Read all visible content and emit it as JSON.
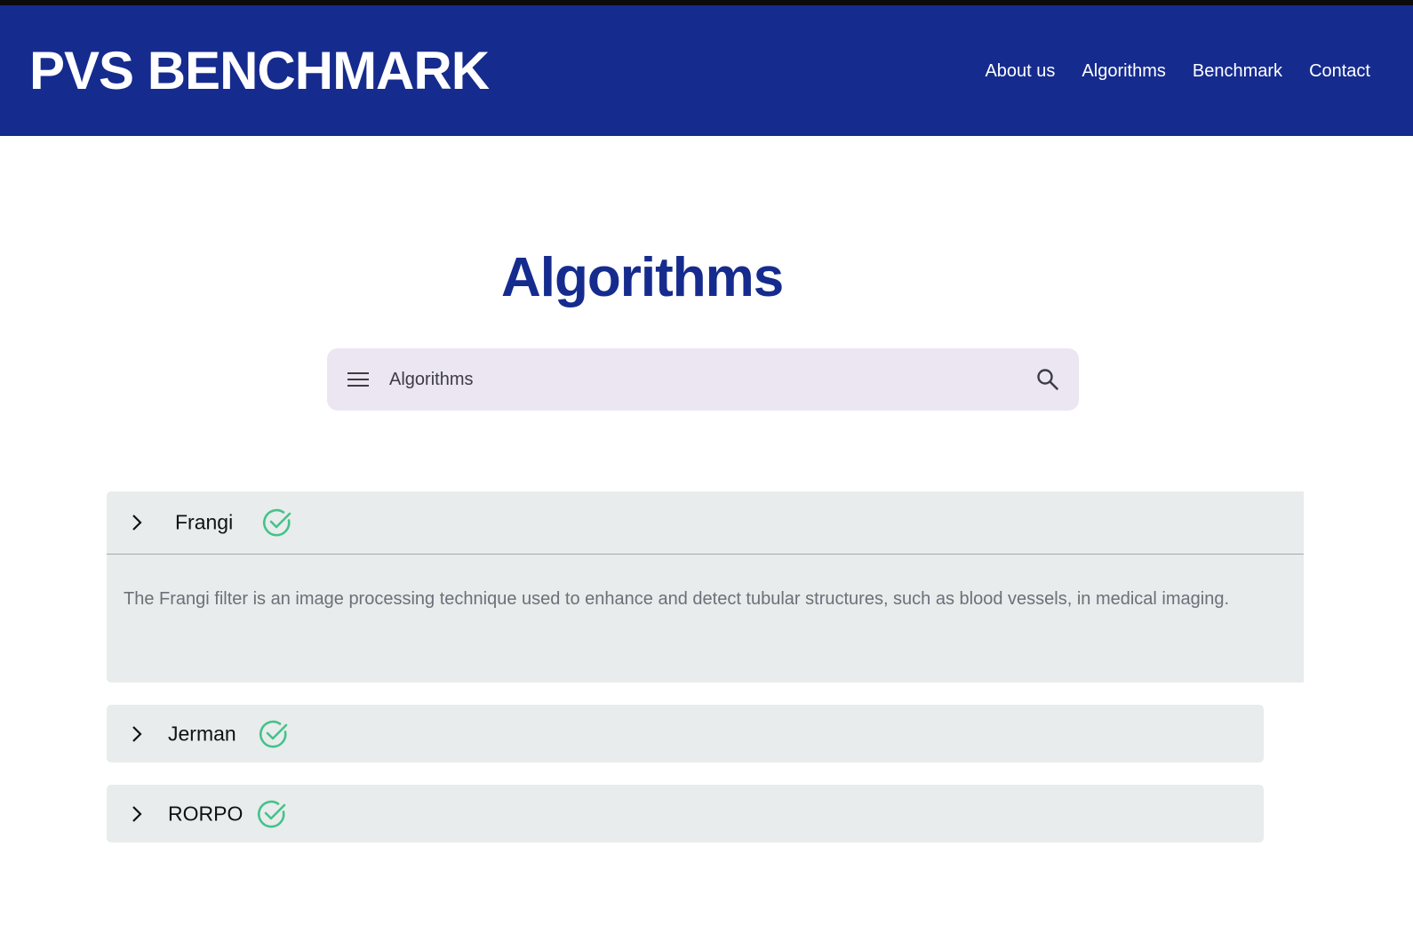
{
  "site": {
    "brand": "PVS BENCHMARK",
    "nav": [
      "About us",
      "Algorithms",
      "Benchmark",
      "Contact"
    ]
  },
  "page": {
    "title": "Algorithms"
  },
  "search": {
    "placeholder": "Algorithms",
    "value": "",
    "menu_icon": "menu-icon",
    "search_icon": "search-icon"
  },
  "algorithms": [
    {
      "name": "Frangi",
      "expanded": true,
      "status_icon": "check-circle-icon",
      "description": "The Frangi filter is an image processing technique used to enhance and detect tubular structures, such as blood vessels, in medical imaging."
    },
    {
      "name": "Jerman",
      "expanded": false,
      "status_icon": "check-circle-icon"
    },
    {
      "name": "RORPO",
      "expanded": false,
      "status_icon": "check-circle-icon"
    }
  ],
  "colors": {
    "header_bg": "#162b8e",
    "title": "#162b8e",
    "search_bg": "#ebe6f1",
    "panel_bg": "#e8ecec",
    "check": "#45c28a",
    "description_text": "#6c7079"
  }
}
